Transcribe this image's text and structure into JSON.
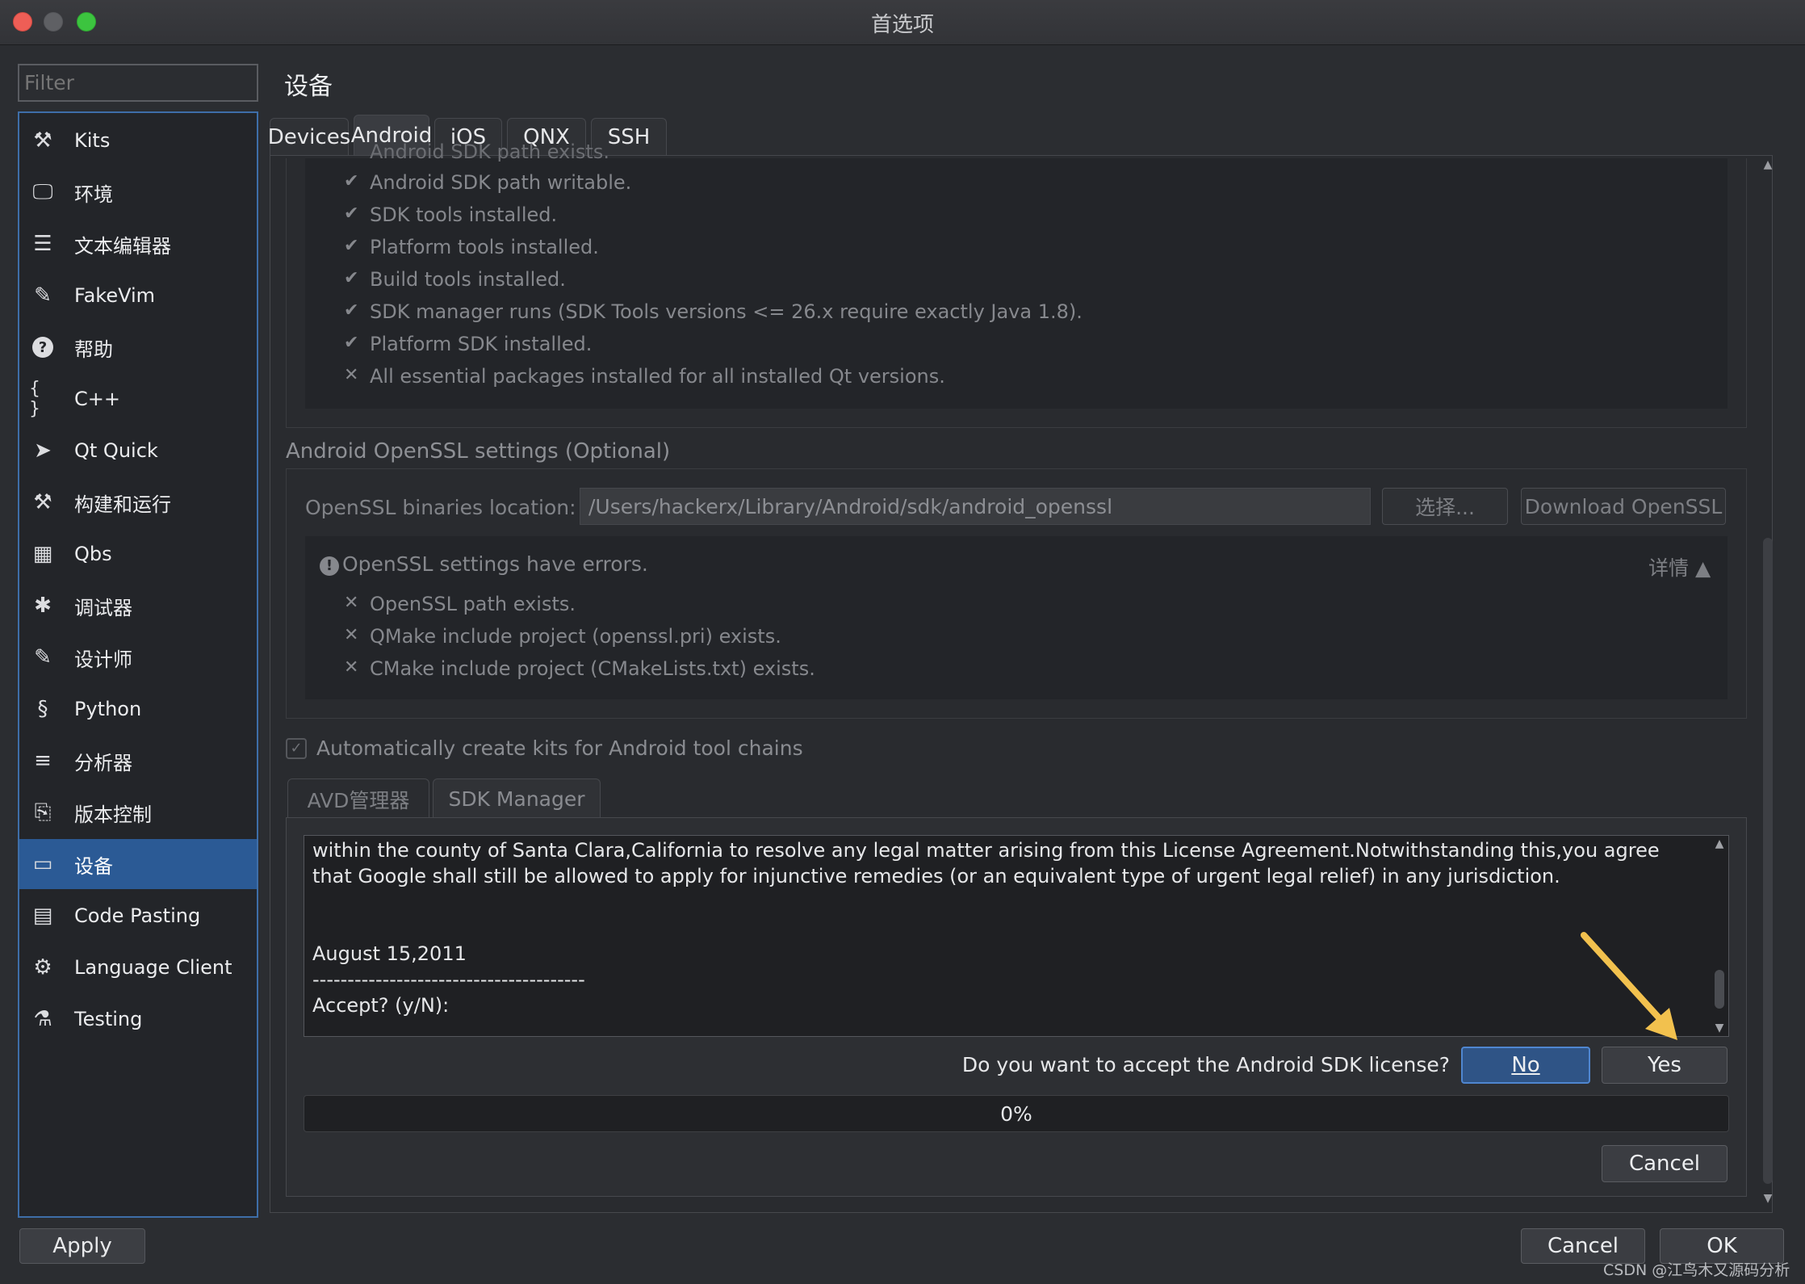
{
  "window": {
    "title": "首选项"
  },
  "filter": {
    "placeholder": "Filter"
  },
  "categories": [
    {
      "label": "Kits",
      "icon": "kits-icon"
    },
    {
      "label": "环境",
      "icon": "monitor-icon"
    },
    {
      "label": "文本编辑器",
      "icon": "text-editor-icon"
    },
    {
      "label": "FakeVim",
      "icon": "fakevim-icon"
    },
    {
      "label": "帮助",
      "icon": "help-icon"
    },
    {
      "label": "C++",
      "icon": "braces-icon"
    },
    {
      "label": "Qt Quick",
      "icon": "paper-plane-icon"
    },
    {
      "label": "构建和运行",
      "icon": "hammer-icon"
    },
    {
      "label": "Qbs",
      "icon": "qbs-grid-icon"
    },
    {
      "label": "调试器",
      "icon": "bug-icon"
    },
    {
      "label": "设计师",
      "icon": "pencil-icon"
    },
    {
      "label": "Python",
      "icon": "python-icon"
    },
    {
      "label": "分析器",
      "icon": "analyzer-icon"
    },
    {
      "label": "版本控制",
      "icon": "version-control-icon"
    },
    {
      "label": "设备",
      "icon": "device-icon",
      "selected": true
    },
    {
      "label": "Code Pasting",
      "icon": "clipboard-icon"
    },
    {
      "label": "Language Client",
      "icon": "language-client-icon"
    },
    {
      "label": "Testing",
      "icon": "flask-icon"
    }
  ],
  "page": {
    "title": "设备",
    "tabs": [
      "Devices",
      "Android",
      "iOS",
      "QNX",
      "SSH"
    ],
    "active_tab": "Android"
  },
  "sdk_checks": {
    "cut_off_text": "Android SDK path exists.",
    "items": [
      {
        "mark": "✔",
        "text": "Android SDK path writable."
      },
      {
        "mark": "✔",
        "text": "SDK tools installed."
      },
      {
        "mark": "✔",
        "text": "Platform tools installed."
      },
      {
        "mark": "✔",
        "text": "Build tools installed."
      },
      {
        "mark": "✔",
        "text": "SDK manager runs (SDK Tools versions <= 26.x require exactly Java 1.8)."
      },
      {
        "mark": "✔",
        "text": "Platform SDK installed."
      },
      {
        "mark": "✕",
        "text": "All essential packages installed for all installed Qt versions."
      }
    ]
  },
  "openssl": {
    "group_title": "Android OpenSSL settings (Optional)",
    "location_label": "OpenSSL binaries location:",
    "location_value": "/Users/hackerx/Library/Android/sdk/android_openssl",
    "choose_label": "选择...",
    "download_label": "Download OpenSSL",
    "error_summary": "OpenSSL settings have errors.",
    "details_label": "详情 ▲",
    "items": [
      {
        "mark": "✕",
        "text": "OpenSSL path exists."
      },
      {
        "mark": "✕",
        "text": "QMake include project (openssl.pri) exists."
      },
      {
        "mark": "✕",
        "text": "CMake include project (CMakeLists.txt) exists."
      }
    ]
  },
  "auto_kits": {
    "label": "Automatically create kits for Android tool chains",
    "checked": true
  },
  "sub_tabs": [
    "AVD管理器",
    "SDK Manager"
  ],
  "license": {
    "lines": [
      "within the county of Santa Clara,California to resolve any legal matter arising from this License Agreement.Notwithstanding this,you agree",
      "that Google shall still be allowed to apply for injunctive remedies (or an equivalent type of urgent legal relief) in any jurisdiction.",
      "",
      "",
      "August 15,2011",
      "---------------------------------------",
      "Accept? (y/N):"
    ]
  },
  "prompt": {
    "question": "Do you want to accept the Android SDK license?",
    "no_label": "No",
    "yes_label": "Yes"
  },
  "progress": {
    "value": 0,
    "text": "0%"
  },
  "sdk_cancel_label": "Cancel",
  "footer": {
    "apply_label": "Apply",
    "cancel_label": "Cancel",
    "ok_label": "OK"
  },
  "watermark": "CSDN @江鸟木又源码分析",
  "colors": {
    "accent": "#2b5a95",
    "annotation_arrow": "#f2c14e",
    "window_bg": "#2b2d31"
  }
}
